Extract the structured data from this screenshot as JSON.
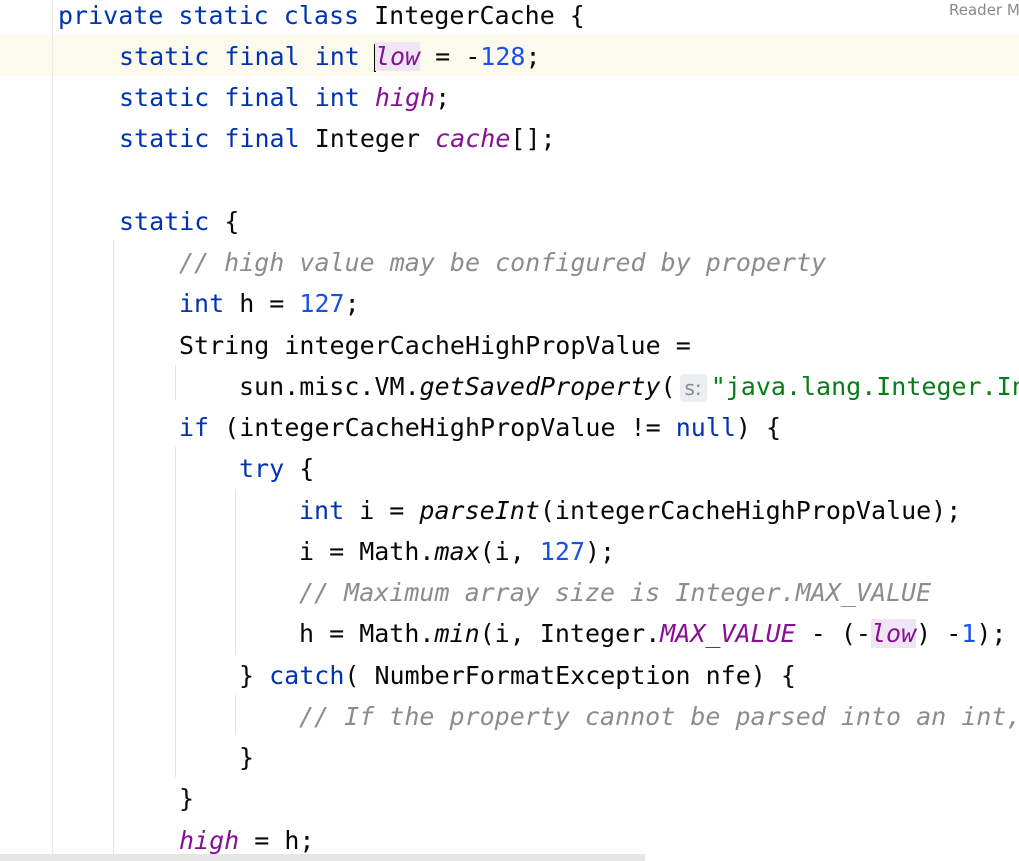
{
  "editor": {
    "reader_mode_label": "Reader Mode",
    "lines": {
      "l1": {
        "kw1": "private",
        "kw2": "static",
        "kw3": "class",
        "name": "IntegerCache",
        "brace": " {"
      },
      "l2": {
        "kw1": "static",
        "kw2": "final",
        "kw3": "int",
        "field": "low",
        "assign": " = -",
        "num": "128",
        "end": ";"
      },
      "l3": {
        "kw1": "static",
        "kw2": "final",
        "kw3": "int",
        "field": "high",
        "end": ";"
      },
      "l4": {
        "kw1": "static",
        "kw2": "final",
        "type": "Integer",
        "field": "cache",
        "end": "[];"
      },
      "l6": {
        "kw": "static",
        "brace": " {"
      },
      "l7": {
        "comment": "// high value may be configured by property"
      },
      "l8": {
        "kw": "int",
        "rest": " h = ",
        "num": "127",
        "end": ";"
      },
      "l9": {
        "text": "String integerCacheHighPropValue ="
      },
      "l10": {
        "prefix": "sun.misc.VM.",
        "method": "getSavedProperty",
        "paren": "(",
        "hint": "s:",
        "str": "\"java.lang.Integer.IntegerCache.high\""
      },
      "l11": {
        "kw": "if",
        "mid": " (integerCacheHighPropValue != ",
        "kw2": "null",
        "end": ") {"
      },
      "l12": {
        "kw": "try",
        "end": " {"
      },
      "l13": {
        "kw": "int",
        "mid": " i = ",
        "method": "parseInt",
        "end": "(integerCacheHighPropValue);"
      },
      "l14": {
        "pre": "i = Math.",
        "method": "max",
        "mid": "(i, ",
        "num": "127",
        "end": ");"
      },
      "l15": {
        "comment": "// Maximum array size is Integer.MAX_VALUE"
      },
      "l16": {
        "pre": "h = Math.",
        "method": "min",
        "mid": "(i, Integer.",
        "const": "MAX_VALUE",
        "mid2": " - (-",
        "field": "low",
        "mid3": ") -",
        "num": "1",
        "end": ");"
      },
      "l17": {
        "pre": "} ",
        "kw": "catch",
        "end": "( NumberFormatException nfe) {"
      },
      "l18": {
        "comment": "// If the property cannot be parsed into an int, ignore it."
      },
      "l19": {
        "text": "}"
      },
      "l20": {
        "text": "}"
      },
      "l21": {
        "field": "high",
        "end": " = h;"
      }
    }
  }
}
